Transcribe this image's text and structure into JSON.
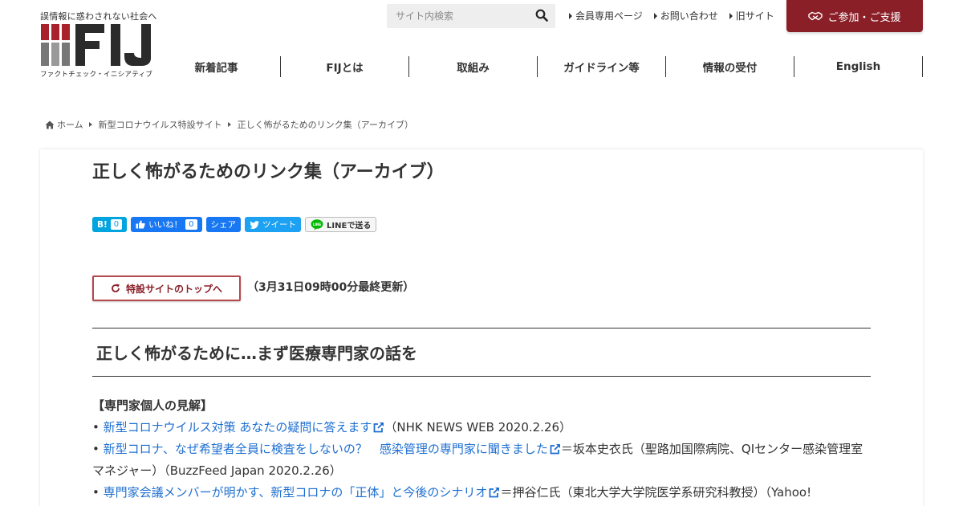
{
  "header": {
    "tagline": "誤情報に惑わされない社会へ",
    "logo_text": "FIJ",
    "logo_caption": "ファクトチェック・イニシアティブ",
    "brand_color": "#8a1f28",
    "search_placeholder": "サイト内検索",
    "util_links": [
      "会員専用ページ",
      "お問い合わせ",
      "旧サイト"
    ],
    "join_label": "ご参加・ご支援",
    "nav": [
      "新着記事",
      "FIJとは",
      "取組み",
      "ガイドライン等",
      "情報の受付",
      "English"
    ]
  },
  "breadcrumb": [
    "ホーム",
    "新型コロナウイルス特設サイト",
    "正しく怖がるためのリンク集（アーカイブ）"
  ],
  "article": {
    "title": "正しく怖がるためのリンク集（アーカイブ）",
    "share": {
      "hatena_label": "B!",
      "hatena_count": "0",
      "like_label": "いいね！",
      "like_count": "0",
      "share_label": "シェア",
      "tweet_label": "ツイート",
      "line_label": "LINEで送る"
    },
    "top_button_label": "特設サイトのトップへ",
    "updated": "（3月31日09時00分最終更新）",
    "section_title": "正しく怖がるために…まず医療専門家の話を",
    "subhead": "【専門家個人の見解】",
    "items": [
      {
        "link": "新型コロナウイルス対策 あなたの疑問に答えます",
        "note": "（NHK NEWS WEB 2020.2.26）"
      },
      {
        "link": "新型コロナ、なぜ希望者全員に検査をしないの？　感染管理の専門家に聞きました",
        "note": "＝坂本史衣氏（聖路加国際病院、QIセンター感染管理室マネジャー）（BuzzFeed Japan 2020.2.26）"
      },
      {
        "link": "専門家会議メンバーが明かす、新型コロナの「正体」と今後のシナリオ",
        "note": "＝押谷仁氏（東北大学大学院医学系研究科教授）（Yahoo!"
      }
    ],
    "link_color": "#1e6fd1"
  }
}
